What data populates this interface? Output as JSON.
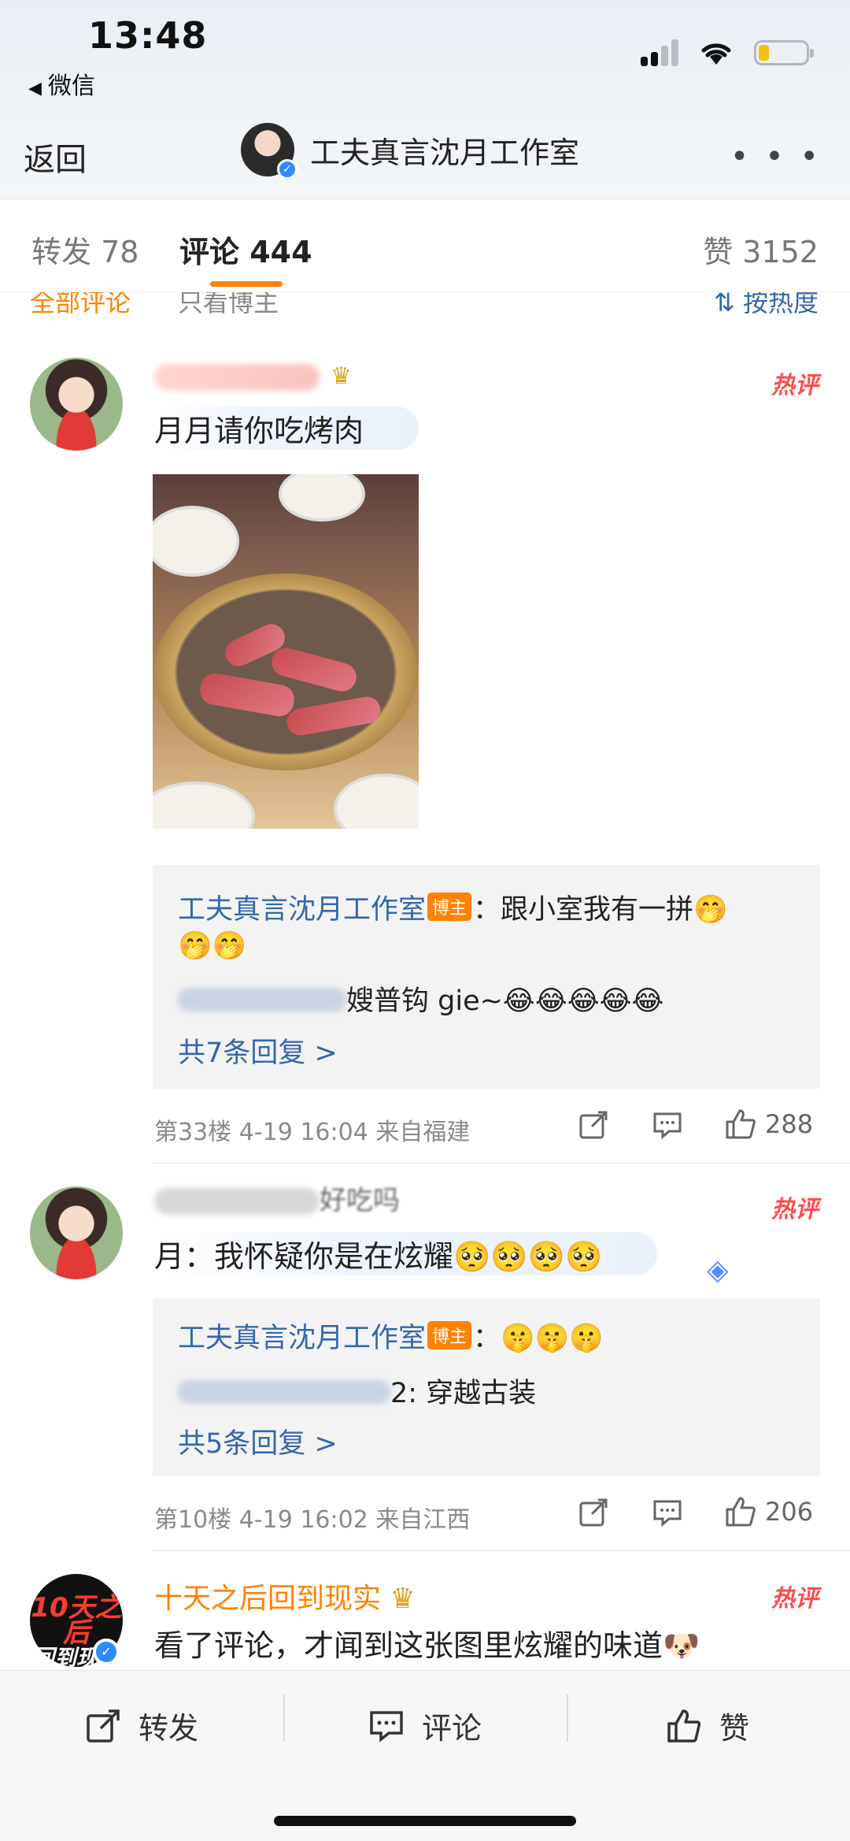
{
  "status_bar": {
    "time": "13:48",
    "back_app": "微信"
  },
  "nav": {
    "back": "返回",
    "title": "工夫真言沈月工作室",
    "more": "• • •"
  },
  "tabs": [
    {
      "label": "转发 78"
    },
    {
      "label": "评论 444"
    },
    {
      "label": "赞 3152"
    }
  ],
  "filters": {
    "all": "全部评论",
    "owner_only": "只看博主",
    "sort": "按热度"
  },
  "comments": [
    {
      "text": "月月请你吃烤肉",
      "hot_tag": "热评",
      "replies": [
        {
          "author": "工夫真言沈月工作室",
          "tag": "博主",
          "text": "：跟小室我有一拼🤭",
          "text2": "🤭🤭"
        },
        {
          "text": "嫂普钩 gie~😂😂😂😂😂"
        }
      ],
      "more_replies": "共7条回复 >",
      "meta": "第33楼  4-19 16:04  来自福建",
      "likes": "288"
    },
    {
      "name_partial": "好吃吗",
      "text": "月：我怀疑你是在炫耀🥺🥺🥺🥺",
      "hot_tag": "热评",
      "replies": [
        {
          "author": "工夫真言沈月工作室",
          "tag": "博主",
          "text": "：🤫🤫🤫"
        },
        {
          "text": "2: 穿越古装"
        }
      ],
      "more_replies": "共5条回复 >",
      "meta": "第10楼  4-19 16:02  来自江西",
      "likes": "206"
    },
    {
      "name": "十天之后回到现实",
      "avatar_text_1": "10天之后",
      "avatar_text_2": "回到现实",
      "text": "看了评论，才闻到这张图里炫耀的味道🐶",
      "hot_tag": "热评"
    }
  ],
  "bottom_bar": {
    "repost": "转发",
    "comment": "评论",
    "like": "赞"
  }
}
